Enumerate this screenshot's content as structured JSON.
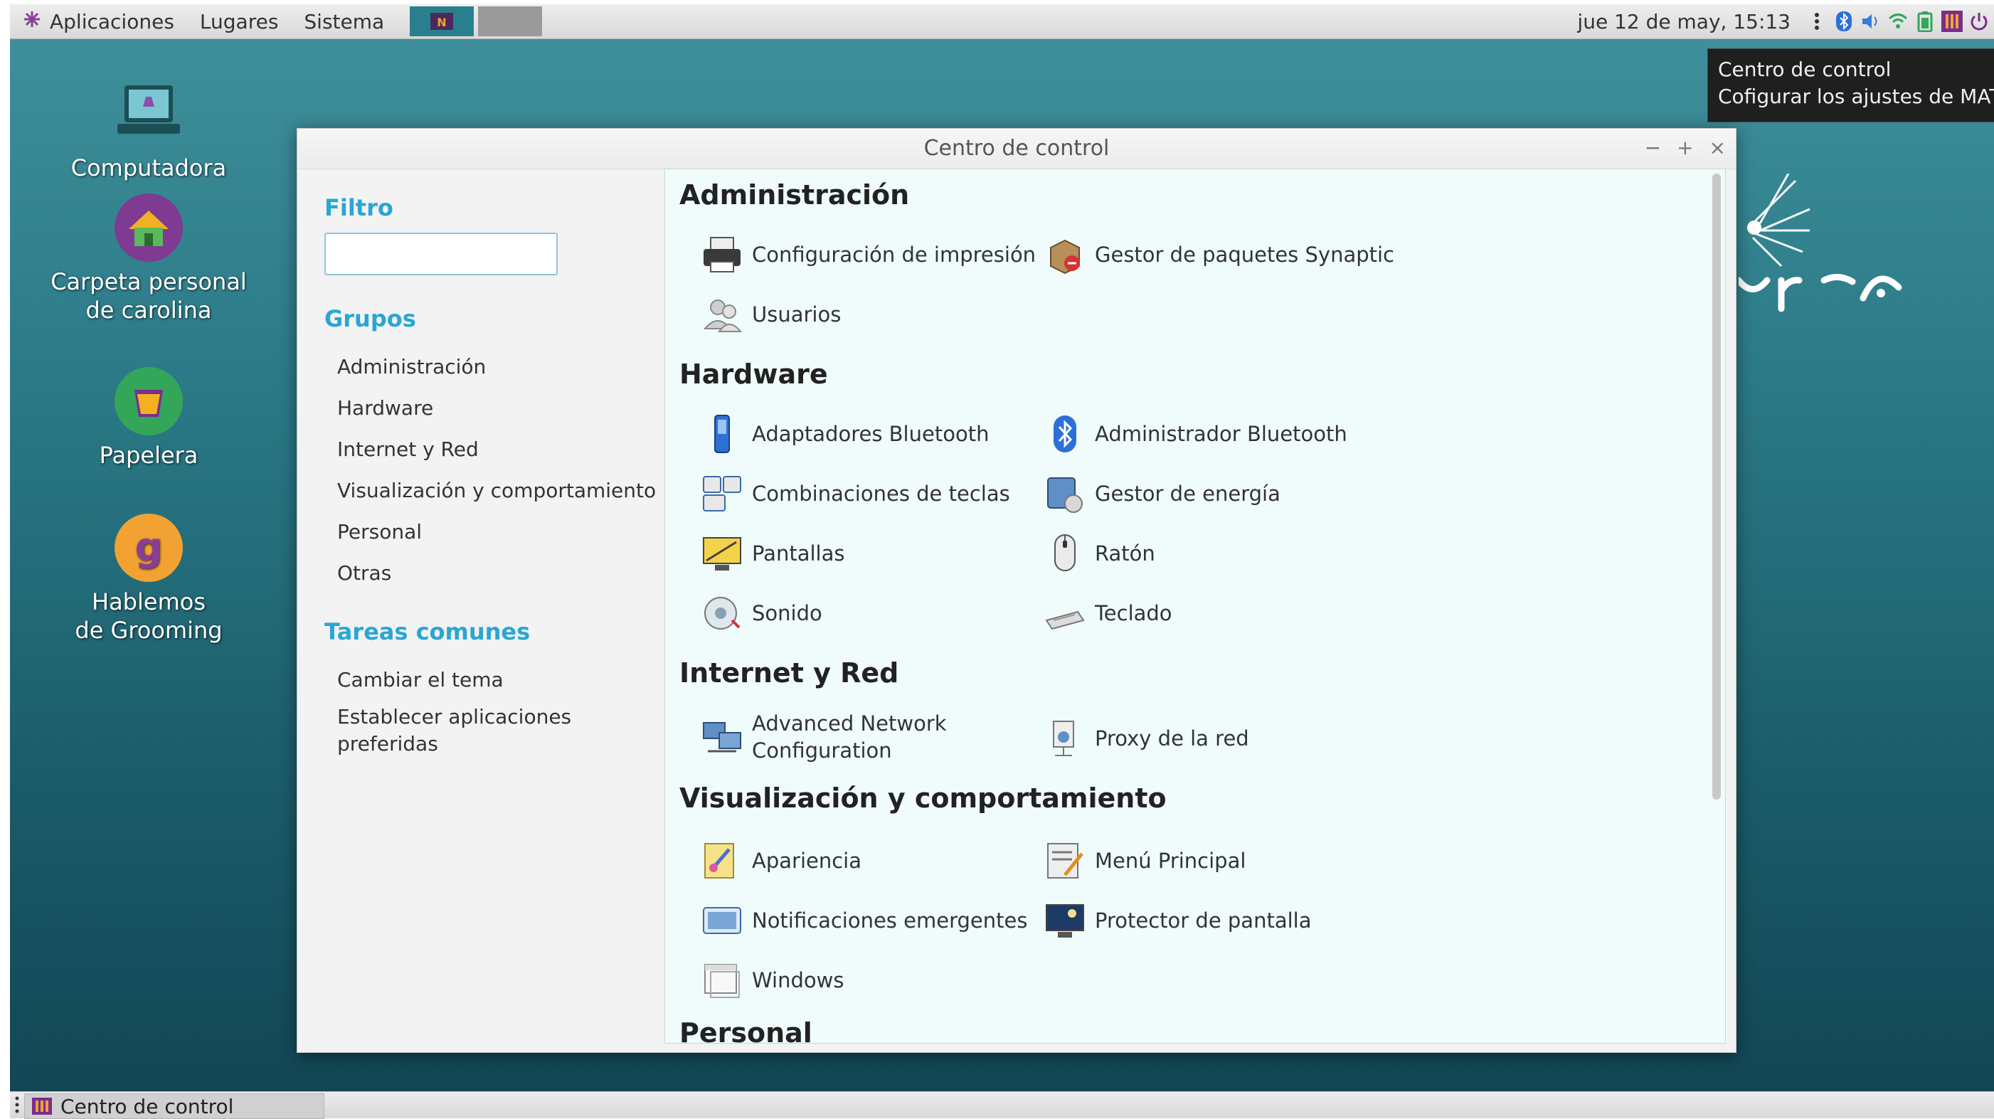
{
  "top_panel": {
    "menus": [
      "Aplicaciones",
      "Lugares",
      "Sistema"
    ],
    "clock": "jue 12 de may, 15:13"
  },
  "tooltip": {
    "title": "Centro de control",
    "description": "Cofigurar los ajustes de MATE"
  },
  "desktop": {
    "icons": [
      {
        "label": "Computadora",
        "icon": "computer-icon"
      },
      {
        "label": "Carpeta personal de carolina",
        "icon": "home-folder-icon"
      },
      {
        "label": "Papelera",
        "icon": "trash-icon"
      },
      {
        "label": "Hablemos de Grooming",
        "icon": "launcher-g-icon"
      }
    ],
    "brand": {
      "logo": "ycra",
      "sub": "n u +"
    }
  },
  "window": {
    "title": "Centro de control",
    "sidebar": {
      "filter_heading": "Filtro",
      "search_value": "",
      "groups_heading": "Grupos",
      "groups": [
        "Administración",
        "Hardware",
        "Internet y Red",
        "Visualización y comportamiento",
        "Personal",
        "Otras"
      ],
      "tasks_heading": "Tareas comunes",
      "tasks": [
        "Cambiar el tema",
        "Establecer aplicaciones preferidas"
      ]
    },
    "sections": [
      {
        "title": "Administración",
        "items": [
          {
            "label": "Configuración de impresión",
            "icon": "printer-icon"
          },
          {
            "label": "Gestor de paquetes Synaptic",
            "icon": "synaptic-icon"
          },
          {
            "label": "Usuarios",
            "icon": "users-icon"
          }
        ]
      },
      {
        "title": "Hardware",
        "items": [
          {
            "label": "Adaptadores Bluetooth",
            "icon": "bluetooth-device-icon"
          },
          {
            "label": "Administrador Bluetooth",
            "icon": "bluetooth-icon"
          },
          {
            "label": "Combinaciones de teclas",
            "icon": "keybinding-icon"
          },
          {
            "label": "Gestor de energía",
            "icon": "power-icon"
          },
          {
            "label": "Pantallas",
            "icon": "display-icon"
          },
          {
            "label": "Ratón",
            "icon": "mouse-icon"
          },
          {
            "label": "Sonido",
            "icon": "sound-icon"
          },
          {
            "label": "Teclado",
            "icon": "keyboard-icon"
          }
        ]
      },
      {
        "title": "Internet y Red",
        "items": [
          {
            "label": "Advanced Network Configuration",
            "icon": "network-icon"
          },
          {
            "label": "Proxy de la red",
            "icon": "proxy-icon"
          }
        ]
      },
      {
        "title": "Visualización y comportamiento",
        "items": [
          {
            "label": "Apariencia",
            "icon": "appearance-icon"
          },
          {
            "label": "Menú Principal",
            "icon": "main-menu-icon"
          },
          {
            "label": "Notificaciones emergentes",
            "icon": "notification-icon"
          },
          {
            "label": "Protector de pantalla",
            "icon": "screensaver-icon"
          },
          {
            "label": "Windows",
            "icon": "windows-icon"
          }
        ]
      },
      {
        "title": "Personal",
        "items": []
      }
    ]
  },
  "bottom_panel": {
    "task": "Centro de control"
  }
}
